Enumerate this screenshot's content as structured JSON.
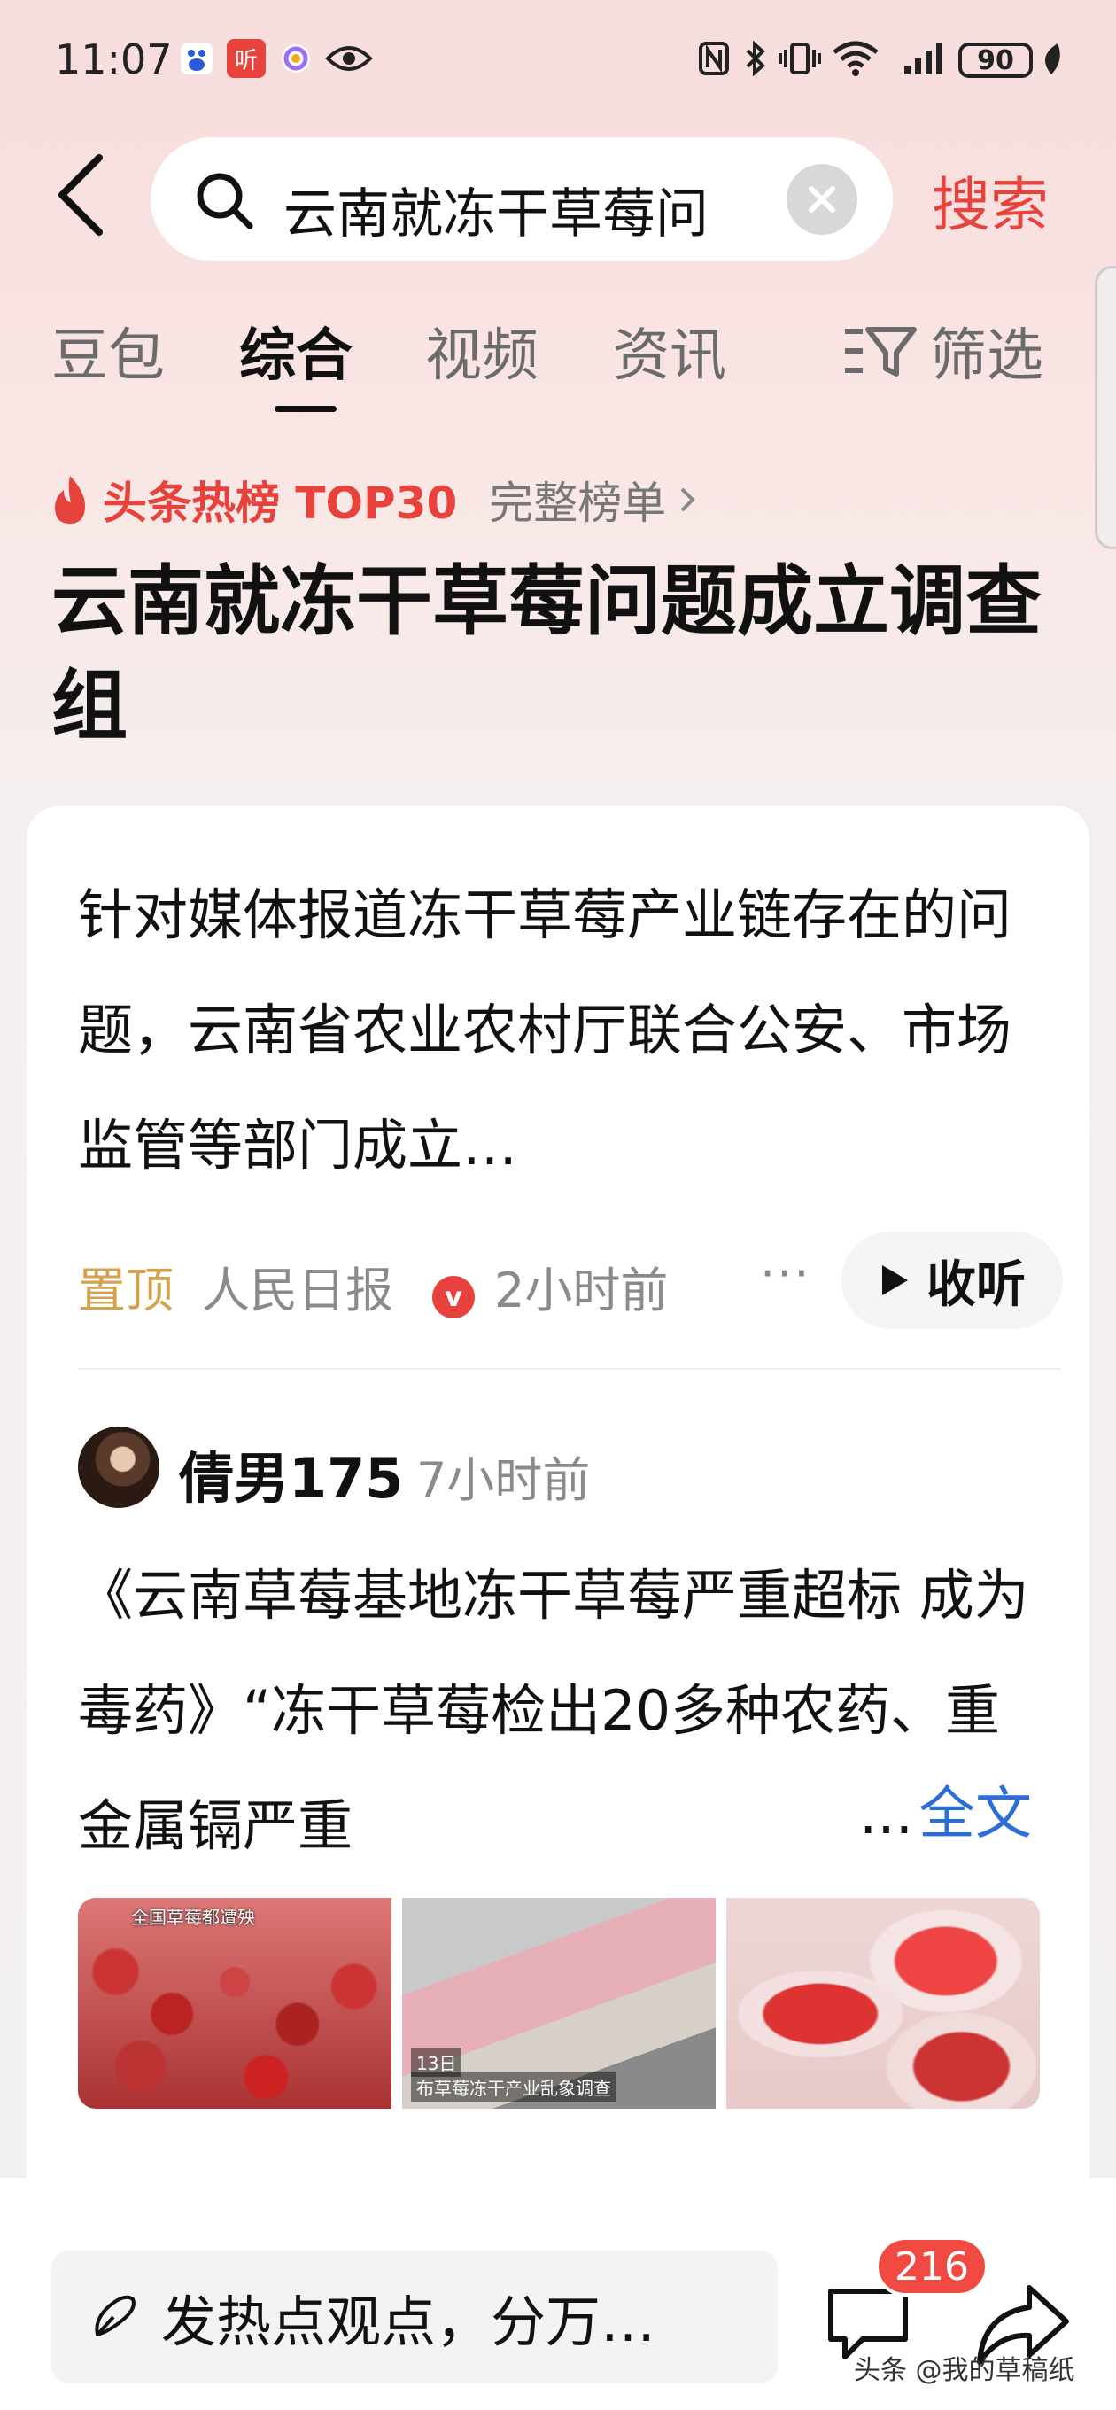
{
  "status_bar": {
    "time": "11:07",
    "battery": "90",
    "icons": [
      "baidu-app-icon",
      "audio-app-icon",
      "browser-app-icon",
      "eye-icon",
      "nfc-icon",
      "bluetooth-icon",
      "vibrate-icon",
      "wifi-icon",
      "signal-icon",
      "leaf-icon"
    ],
    "audio_app_label": "听"
  },
  "search": {
    "query": "云南就冻干草莓问",
    "button_label": "搜索"
  },
  "tabs": [
    {
      "label": "豆包",
      "active": false
    },
    {
      "label": "综合",
      "active": true
    },
    {
      "label": "视频",
      "active": false
    },
    {
      "label": "资讯",
      "active": false
    }
  ],
  "filter_label": "筛选",
  "hot_rank": {
    "label": "头条热榜 TOP30",
    "full_list": "完整榜单",
    "title": "云南就冻干草莓问题成立调查组"
  },
  "news": {
    "summary": "针对媒体报道冻干草莓产业链存在的问题，云南省农业农村厅联合公安、市场监管等部门成立…",
    "pinned": "置顶",
    "source": "人民日报",
    "verified_mark": "v",
    "time": "2小时前",
    "more": "···",
    "listen_label": "收听"
  },
  "post": {
    "author": "倩男175",
    "time": "7小时前",
    "text": "《云南草莓基地冻干草莓严重超标 成为毒药》“冻干草莓检出20多种农药、重金属镉严重",
    "ellipsis": "...",
    "full_text_link": "全文",
    "thumb_captions": [
      "全国草莓都遭殃",
      "13日",
      "布草莓冻干产业乱象调查"
    ]
  },
  "bottom_bar": {
    "comment_placeholder": "发热点观点，分万…",
    "comment_count": "216"
  },
  "watermark": "头条 @我的草稿纸",
  "colors": {
    "accent": "#e8423c",
    "link": "#2b6fd6",
    "pinned": "#d4a24c"
  }
}
